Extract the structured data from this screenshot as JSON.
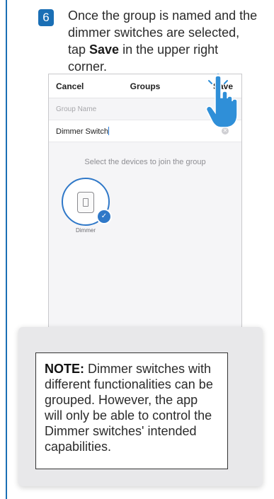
{
  "step": {
    "number": "6",
    "text_before": "Once the group is named and the dimmer switches are selected, tap ",
    "bold_word": "Save",
    "text_after": " in the upper right corner."
  },
  "app": {
    "nav": {
      "cancel": "Cancel",
      "title": "Groups",
      "save": "Save"
    },
    "group_name_label": "Group Name",
    "group_name_value": "Dimmer Switch",
    "prompt": "Select the devices to join the group",
    "device": {
      "label": "Dimmer",
      "selected": true,
      "icon": "light-switch-icon"
    },
    "accent_color": "#2f78c8"
  },
  "note": {
    "label": "NOTE:",
    "text": " Dimmer switches with different functionalities can be grouped. However, the app will only be able to control the Dimmer switches' intended capabilities."
  },
  "colors": {
    "brand_blue": "#1a6fb5"
  }
}
